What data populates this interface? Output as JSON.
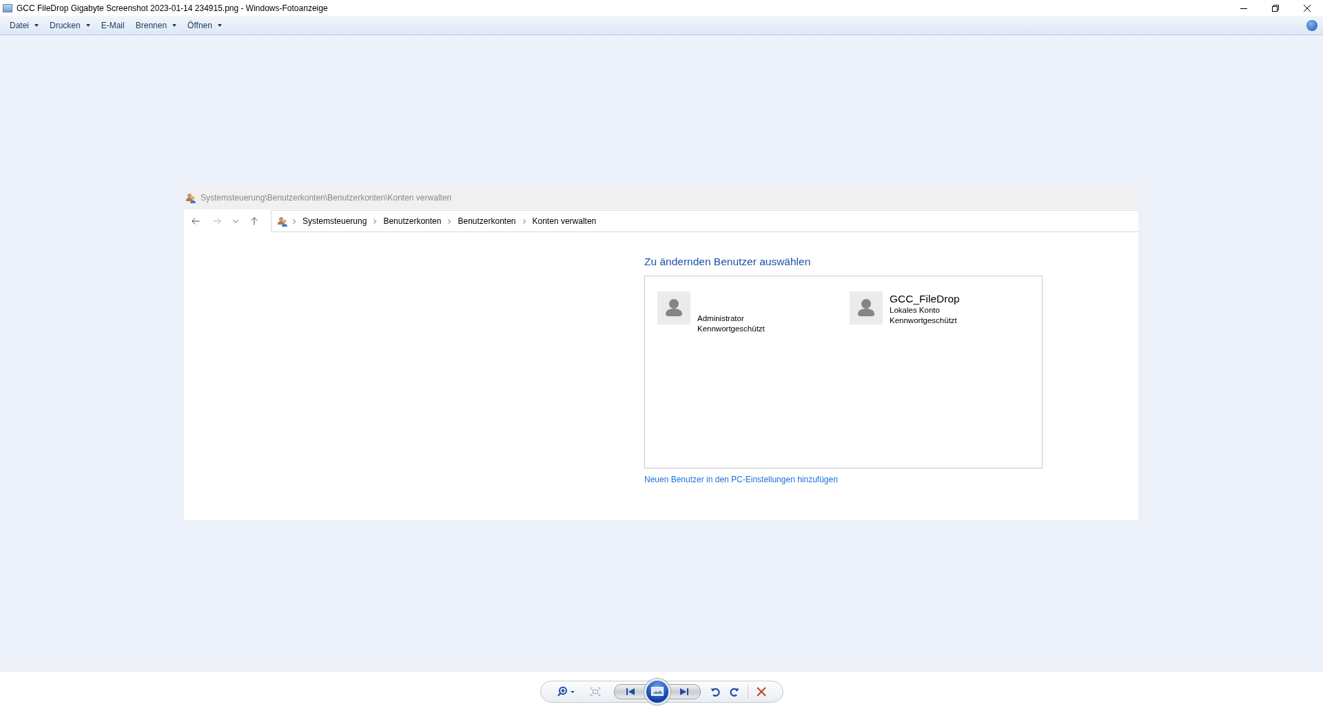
{
  "window": {
    "title": "GCC FileDrop Gigabyte Screenshot 2023-01-14 234915.png - Windows-Fotoanzeige"
  },
  "menu": [
    {
      "label": "Datei",
      "dropdown": true
    },
    {
      "label": "Drucken",
      "dropdown": true
    },
    {
      "label": "E-Mail",
      "dropdown": false
    },
    {
      "label": "Brennen",
      "dropdown": true
    },
    {
      "label": "Öffnen",
      "dropdown": true
    }
  ],
  "shown_image": {
    "window_title": "Systemsteuerung\\Benutzerkonten\\Benutzerkonten\\Konten verwalten",
    "nav": {
      "back_enabled": true,
      "forward_enabled": false
    },
    "breadcrumb": [
      "Systemsteuerung",
      "Benutzerkonten",
      "Benutzerkonten",
      "Konten verwalten"
    ],
    "heading": "Zu ändernden Benutzer auswählen",
    "users": [
      {
        "details": [
          "Administrator",
          "Kennwortgeschützt"
        ]
      },
      {
        "title": "GCC_FileDrop",
        "details": [
          "Lokales Konto",
          "Kennwortgeschützt"
        ]
      }
    ],
    "link": "Neuen Benutzer in den PC-Einstellungen hinzufügen"
  }
}
